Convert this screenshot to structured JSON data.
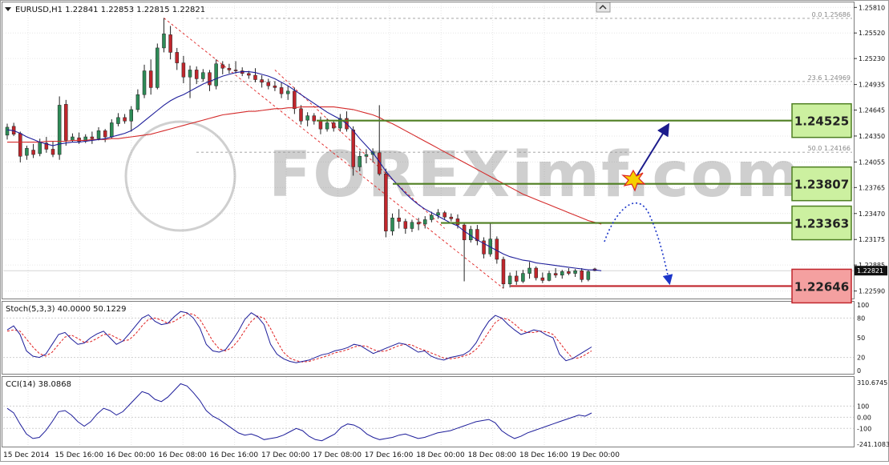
{
  "header": {
    "symbol_caption": "EURUSD,H1  1.22841 1.22853 1.22815 1.22821",
    "menu_icon": "triangle-down-icon",
    "corner_icon": "chart-arrow-icon"
  },
  "price_axis": {
    "ticks": [
      1.2581,
      1.2552,
      1.2523,
      1.24935,
      1.24645,
      1.2435,
      1.24055,
      1.23765,
      1.2347,
      1.23175,
      1.22885,
      1.2259
    ],
    "tick_labels": [
      "1.25810",
      "1.25520",
      "1.25230",
      "1.24935",
      "1.24645",
      "1.24350",
      "1.24055",
      "1.23765",
      "1.23470",
      "1.23175",
      "1.22885",
      "1.22590"
    ],
    "current_price": "1.22821",
    "range": [
      1.2255,
      1.2584
    ]
  },
  "time_axis": [
    "15 Dec 2014",
    "15 Dec 16:00",
    "16 Dec 00:00",
    "16 Dec 08:00",
    "16 Dec 16:00",
    "17 Dec 00:00",
    "17 Dec 08:00",
    "17 Dec 16:00",
    "18 Dec 00:00",
    "18 Dec 08:00",
    "18 Dec 16:00",
    "19 Dec 00:00"
  ],
  "fibonacci": [
    {
      "label": "0.0  1.25686",
      "price": 1.25686
    },
    {
      "label": "23.6  1.24969",
      "price": 1.24969
    },
    {
      "label": "50.0  1.24166",
      "price": 1.24166
    }
  ],
  "levels": [
    {
      "label": "1.24525",
      "price": 1.24525,
      "kind": "resistance",
      "color": "#4f7f22",
      "fill": "#ccf0a0"
    },
    {
      "label": "1.23807",
      "price": 1.23807,
      "kind": "resistance",
      "color": "#4f7f22",
      "fill": "#ccf0a0"
    },
    {
      "label": "1.23363",
      "price": 1.23363,
      "kind": "resistance",
      "color": "#4f7f22",
      "fill": "#ccf0a0"
    },
    {
      "label": "1.22646",
      "price": 1.22646,
      "kind": "support",
      "color": "#c0262c",
      "fill": "#f4a0a0"
    }
  ],
  "watermark": "FOREXimf.com",
  "stoch": {
    "caption": "Stoch(5,3,3) 40.0000 50.1229",
    "tick_labels": [
      "100",
      "80",
      "50",
      "20",
      "0"
    ],
    "tick_values": [
      100,
      80,
      50,
      20,
      0
    ]
  },
  "cci": {
    "caption": "CCI(14) 38.0868",
    "tick_labels": [
      "310.6745",
      "100",
      "0.00",
      "-100",
      "-241.1083"
    ],
    "tick_values": [
      310.6745,
      100,
      0,
      -100,
      -241.1083
    ]
  },
  "colors": {
    "bull": "#2e8b57",
    "bear": "#c0262c",
    "ma_fast": "#1d1d9a",
    "ma_slow": "#d42a2a",
    "stoch_main": "#1d1d9a",
    "stoch_signal": "#e02020",
    "cci": "#1d1d9a",
    "arrow": "#1c1c8c"
  },
  "chart_data": {
    "type": "candlestick",
    "symbol": "EURUSD",
    "timeframe": "H1",
    "candles": [
      {
        "o": 1.2436,
        "h": 1.2449,
        "l": 1.2431,
        "c": 1.2445
      },
      {
        "o": 1.2446,
        "h": 1.245,
        "l": 1.2435,
        "c": 1.2437
      },
      {
        "o": 1.2438,
        "h": 1.244,
        "l": 1.2405,
        "c": 1.2412
      },
      {
        "o": 1.2413,
        "h": 1.2424,
        "l": 1.2408,
        "c": 1.2421
      },
      {
        "o": 1.2419,
        "h": 1.2426,
        "l": 1.241,
        "c": 1.2414
      },
      {
        "o": 1.2415,
        "h": 1.2432,
        "l": 1.2412,
        "c": 1.2428
      },
      {
        "o": 1.2427,
        "h": 1.2434,
        "l": 1.2416,
        "c": 1.242
      },
      {
        "o": 1.242,
        "h": 1.2429,
        "l": 1.2411,
        "c": 1.2414
      },
      {
        "o": 1.2414,
        "h": 1.248,
        "l": 1.2408,
        "c": 1.247
      },
      {
        "o": 1.2471,
        "h": 1.2476,
        "l": 1.2424,
        "c": 1.243
      },
      {
        "o": 1.243,
        "h": 1.2438,
        "l": 1.2428,
        "c": 1.2434
      },
      {
        "o": 1.2433,
        "h": 1.2439,
        "l": 1.2426,
        "c": 1.2429
      },
      {
        "o": 1.2429,
        "h": 1.2437,
        "l": 1.2427,
        "c": 1.2434
      },
      {
        "o": 1.2434,
        "h": 1.244,
        "l": 1.2426,
        "c": 1.2432
      },
      {
        "o": 1.2432,
        "h": 1.2445,
        "l": 1.243,
        "c": 1.2441
      },
      {
        "o": 1.2441,
        "h": 1.2443,
        "l": 1.2428,
        "c": 1.2434
      },
      {
        "o": 1.2434,
        "h": 1.2454,
        "l": 1.2432,
        "c": 1.245
      },
      {
        "o": 1.2449,
        "h": 1.2461,
        "l": 1.2446,
        "c": 1.2456
      },
      {
        "o": 1.2456,
        "h": 1.246,
        "l": 1.2449,
        "c": 1.2452
      },
      {
        "o": 1.2452,
        "h": 1.2469,
        "l": 1.244,
        "c": 1.2465
      },
      {
        "o": 1.2465,
        "h": 1.2488,
        "l": 1.2462,
        "c": 1.2482
      },
      {
        "o": 1.2482,
        "h": 1.2516,
        "l": 1.2478,
        "c": 1.2509
      },
      {
        "o": 1.2509,
        "h": 1.2522,
        "l": 1.2482,
        "c": 1.249
      },
      {
        "o": 1.249,
        "h": 1.254,
        "l": 1.2488,
        "c": 1.2535
      },
      {
        "o": 1.2535,
        "h": 1.2569,
        "l": 1.253,
        "c": 1.2551
      },
      {
        "o": 1.255,
        "h": 1.256,
        "l": 1.2522,
        "c": 1.253
      },
      {
        "o": 1.253,
        "h": 1.2535,
        "l": 1.251,
        "c": 1.2518
      },
      {
        "o": 1.2518,
        "h": 1.2526,
        "l": 1.2495,
        "c": 1.2502
      },
      {
        "o": 1.2502,
        "h": 1.2515,
        "l": 1.2478,
        "c": 1.251
      },
      {
        "o": 1.251,
        "h": 1.2514,
        "l": 1.2494,
        "c": 1.25
      },
      {
        "o": 1.25,
        "h": 1.2511,
        "l": 1.2497,
        "c": 1.2507
      },
      {
        "o": 1.2507,
        "h": 1.251,
        "l": 1.2486,
        "c": 1.2493
      },
      {
        "o": 1.2492,
        "h": 1.2522,
        "l": 1.2488,
        "c": 1.2517
      },
      {
        "o": 1.2516,
        "h": 1.252,
        "l": 1.2505,
        "c": 1.2512
      },
      {
        "o": 1.2512,
        "h": 1.2517,
        "l": 1.2506,
        "c": 1.251
      },
      {
        "o": 1.251,
        "h": 1.252,
        "l": 1.2506,
        "c": 1.2509
      },
      {
        "o": 1.2509,
        "h": 1.2513,
        "l": 1.2503,
        "c": 1.2506
      },
      {
        "o": 1.2506,
        "h": 1.2509,
        "l": 1.25,
        "c": 1.2504
      },
      {
        "o": 1.2504,
        "h": 1.2512,
        "l": 1.2496,
        "c": 1.2499
      },
      {
        "o": 1.2499,
        "h": 1.2504,
        "l": 1.249,
        "c": 1.2496
      },
      {
        "o": 1.2496,
        "h": 1.25,
        "l": 1.2488,
        "c": 1.2492
      },
      {
        "o": 1.2492,
        "h": 1.2497,
        "l": 1.2486,
        "c": 1.249
      },
      {
        "o": 1.249,
        "h": 1.2496,
        "l": 1.2478,
        "c": 1.2483
      },
      {
        "o": 1.2483,
        "h": 1.2492,
        "l": 1.2476,
        "c": 1.2486
      },
      {
        "o": 1.2486,
        "h": 1.249,
        "l": 1.246,
        "c": 1.2466
      },
      {
        "o": 1.2466,
        "h": 1.247,
        "l": 1.2448,
        "c": 1.2452
      },
      {
        "o": 1.2453,
        "h": 1.2462,
        "l": 1.2446,
        "c": 1.2458
      },
      {
        "o": 1.2458,
        "h": 1.2461,
        "l": 1.2448,
        "c": 1.2452
      },
      {
        "o": 1.2452,
        "h": 1.2457,
        "l": 1.2437,
        "c": 1.2443
      },
      {
        "o": 1.2443,
        "h": 1.2455,
        "l": 1.244,
        "c": 1.245
      },
      {
        "o": 1.245,
        "h": 1.2453,
        "l": 1.244,
        "c": 1.2444
      },
      {
        "o": 1.2444,
        "h": 1.246,
        "l": 1.244,
        "c": 1.2455
      },
      {
        "o": 1.2455,
        "h": 1.2463,
        "l": 1.244,
        "c": 1.2443
      },
      {
        "o": 1.2442,
        "h": 1.2446,
        "l": 1.239,
        "c": 1.24
      },
      {
        "o": 1.24,
        "h": 1.2418,
        "l": 1.2395,
        "c": 1.2412
      },
      {
        "o": 1.2412,
        "h": 1.242,
        "l": 1.2404,
        "c": 1.2414
      },
      {
        "o": 1.2414,
        "h": 1.2421,
        "l": 1.2405,
        "c": 1.2417
      },
      {
        "o": 1.2416,
        "h": 1.247,
        "l": 1.239,
        "c": 1.2392
      },
      {
        "o": 1.2392,
        "h": 1.2398,
        "l": 1.232,
        "c": 1.2327
      },
      {
        "o": 1.2327,
        "h": 1.2347,
        "l": 1.2322,
        "c": 1.2342
      },
      {
        "o": 1.2342,
        "h": 1.2352,
        "l": 1.233,
        "c": 1.2338
      },
      {
        "o": 1.2338,
        "h": 1.2341,
        "l": 1.2324,
        "c": 1.233
      },
      {
        "o": 1.233,
        "h": 1.234,
        "l": 1.2326,
        "c": 1.2337
      },
      {
        "o": 1.2337,
        "h": 1.2342,
        "l": 1.2328,
        "c": 1.2335
      },
      {
        "o": 1.2335,
        "h": 1.2344,
        "l": 1.233,
        "c": 1.234
      },
      {
        "o": 1.234,
        "h": 1.2349,
        "l": 1.2337,
        "c": 1.2345
      },
      {
        "o": 1.2345,
        "h": 1.2352,
        "l": 1.2341,
        "c": 1.2348
      },
      {
        "o": 1.2348,
        "h": 1.235,
        "l": 1.234,
        "c": 1.2343
      },
      {
        "o": 1.2343,
        "h": 1.2347,
        "l": 1.2338,
        "c": 1.2341
      },
      {
        "o": 1.2341,
        "h": 1.2346,
        "l": 1.233,
        "c": 1.2334
      },
      {
        "o": 1.2334,
        "h": 1.2337,
        "l": 1.227,
        "c": 1.2317
      },
      {
        "o": 1.2317,
        "h": 1.2333,
        "l": 1.2314,
        "c": 1.2329
      },
      {
        "o": 1.2329,
        "h": 1.2334,
        "l": 1.2311,
        "c": 1.2316
      },
      {
        "o": 1.2316,
        "h": 1.232,
        "l": 1.2296,
        "c": 1.2301
      },
      {
        "o": 1.2301,
        "h": 1.2336,
        "l": 1.2298,
        "c": 1.2318
      },
      {
        "o": 1.2318,
        "h": 1.2321,
        "l": 1.229,
        "c": 1.2295
      },
      {
        "o": 1.2295,
        "h": 1.2298,
        "l": 1.2262,
        "c": 1.2267
      },
      {
        "o": 1.2267,
        "h": 1.228,
        "l": 1.2263,
        "c": 1.2276
      },
      {
        "o": 1.2276,
        "h": 1.2282,
        "l": 1.2266,
        "c": 1.227
      },
      {
        "o": 1.227,
        "h": 1.2283,
        "l": 1.2268,
        "c": 1.2279
      },
      {
        "o": 1.2279,
        "h": 1.2292,
        "l": 1.2273,
        "c": 1.2285
      },
      {
        "o": 1.2285,
        "h": 1.2287,
        "l": 1.2271,
        "c": 1.2274
      },
      {
        "o": 1.2274,
        "h": 1.228,
        "l": 1.2268,
        "c": 1.2271
      },
      {
        "o": 1.2271,
        "h": 1.2282,
        "l": 1.227,
        "c": 1.2279
      },
      {
        "o": 1.2279,
        "h": 1.2285,
        "l": 1.2274,
        "c": 1.2277
      },
      {
        "o": 1.2277,
        "h": 1.2283,
        "l": 1.2273,
        "c": 1.2281
      },
      {
        "o": 1.2281,
        "h": 1.2285,
        "l": 1.2277,
        "c": 1.2279
      },
      {
        "o": 1.2279,
        "h": 1.2284,
        "l": 1.2275,
        "c": 1.2282
      },
      {
        "o": 1.2282,
        "h": 1.2285,
        "l": 1.2269,
        "c": 1.2272
      },
      {
        "o": 1.2272,
        "h": 1.2283,
        "l": 1.227,
        "c": 1.2281
      },
      {
        "o": 1.22841,
        "h": 1.22853,
        "l": 1.22815,
        "c": 1.22821
      }
    ],
    "ma_fast": [
      1.2442,
      1.2441,
      1.2438,
      1.2434,
      1.2431,
      1.2428,
      1.2426,
      1.2424,
      1.2426,
      1.2427,
      1.2428,
      1.2428,
      1.2429,
      1.243,
      1.2431,
      1.2432,
      1.2434,
      1.2436,
      1.2438,
      1.2441,
      1.2446,
      1.2452,
      1.2458,
      1.2464,
      1.247,
      1.2475,
      1.2479,
      1.2482,
      1.2486,
      1.249,
      1.2494,
      1.2497,
      1.25,
      1.2503,
      1.2505,
      1.2507,
      1.2508,
      1.2508,
      1.2507,
      1.2505,
      1.2503,
      1.25,
      1.2496,
      1.2492,
      1.2487,
      1.2482,
      1.2477,
      1.2472,
      1.2467,
      1.2462,
      1.2458,
      1.2454,
      1.2449,
      1.2441,
      1.2432,
      1.2424,
      1.2416,
      1.2406,
      1.2395,
      1.2386,
      1.2378,
      1.237,
      1.2363,
      1.2357,
      1.2352,
      1.2348,
      1.2344,
      1.234,
      1.2336,
      1.2333,
      1.2327,
      1.2322,
      1.2317,
      1.2313,
      1.2309,
      1.2305,
      1.2301,
      1.2298,
      1.2296,
      1.2294,
      1.2293,
      1.2291,
      1.229,
      1.2289,
      1.2288,
      1.2287,
      1.2286,
      1.2285,
      1.2284,
      1.2283,
      1.2283,
      1.2282
    ],
    "ma_slow": [
      1.2428,
      1.2428,
      1.2428,
      1.2428,
      1.2428,
      1.2428,
      1.2429,
      1.2429,
      1.2429,
      1.2429,
      1.243,
      1.243,
      1.243,
      1.2431,
      1.2431,
      1.2431,
      1.2432,
      1.2432,
      1.2433,
      1.2434,
      1.2435,
      1.2436,
      1.2437,
      1.2439,
      1.2441,
      1.2443,
      1.2445,
      1.2447,
      1.2449,
      1.2451,
      1.2453,
      1.2455,
      1.2457,
      1.2459,
      1.246,
      1.2461,
      1.2462,
      1.2463,
      1.2463,
      1.2464,
      1.2465,
      1.2466,
      1.2466,
      1.2467,
      1.2467,
      1.2468,
      1.2468,
      1.2468,
      1.2468,
      1.2468,
      1.2468,
      1.2467,
      1.2466,
      1.2465,
      1.2463,
      1.2461,
      1.2459,
      1.2456,
      1.2452,
      1.2449,
      1.2445,
      1.2441,
      1.2437,
      1.2433,
      1.2429,
      1.2425,
      1.2421,
      1.2417,
      1.2413,
      1.2409,
      1.2405,
      1.2401,
      1.2397,
      1.2393,
      1.2389,
      1.2385,
      1.2381,
      1.2377,
      1.2373,
      1.2369,
      1.2366,
      1.2363,
      1.236,
      1.2357,
      1.2354,
      1.2351,
      1.2348,
      1.2345,
      1.2342,
      1.2339,
      1.2337,
      1.2335
    ],
    "stoch_main": [
      62,
      68,
      55,
      30,
      22,
      20,
      25,
      40,
      55,
      58,
      48,
      40,
      42,
      50,
      56,
      60,
      50,
      40,
      45,
      56,
      68,
      80,
      85,
      75,
      70,
      72,
      82,
      90,
      88,
      80,
      65,
      40,
      30,
      28,
      32,
      45,
      60,
      78,
      88,
      82,
      70,
      40,
      25,
      18,
      14,
      12,
      14,
      16,
      20,
      24,
      26,
      30,
      32,
      35,
      40,
      38,
      32,
      26,
      30,
      34,
      38,
      42,
      40,
      34,
      28,
      30,
      22,
      18,
      16,
      20,
      22,
      24,
      30,
      42,
      60,
      75,
      84,
      80,
      70,
      62,
      55,
      58,
      62,
      60,
      54,
      50,
      25,
      15,
      18,
      24,
      30,
      36
    ],
    "stoch_signal": [
      60,
      62,
      60,
      48,
      36,
      26,
      22,
      28,
      40,
      51,
      54,
      49,
      43,
      44,
      49,
      55,
      55,
      50,
      45,
      47,
      56,
      68,
      78,
      80,
      77,
      72,
      75,
      81,
      87,
      86,
      78,
      62,
      45,
      33,
      30,
      35,
      46,
      61,
      75,
      83,
      80,
      64,
      45,
      28,
      19,
      15,
      13,
      14,
      17,
      20,
      23,
      27,
      29,
      32,
      36,
      38,
      37,
      32,
      29,
      30,
      34,
      38,
      40,
      39,
      34,
      31,
      27,
      23,
      19,
      18,
      19,
      22,
      25,
      32,
      44,
      59,
      73,
      80,
      78,
      71,
      62,
      58,
      58,
      60,
      59,
      55,
      43,
      30,
      19,
      19,
      24,
      30
    ],
    "cci": [
      80,
      40,
      -60,
      -150,
      -190,
      -180,
      -120,
      -40,
      50,
      60,
      20,
      -40,
      -80,
      -40,
      30,
      80,
      60,
      20,
      50,
      110,
      170,
      230,
      210,
      160,
      140,
      180,
      240,
      300,
      280,
      220,
      150,
      60,
      10,
      -20,
      -60,
      -100,
      -140,
      -160,
      -150,
      -170,
      -200,
      -190,
      -180,
      -160,
      -130,
      -100,
      -120,
      -170,
      -200,
      -210,
      -180,
      -150,
      -90,
      -60,
      -70,
      -100,
      -150,
      -180,
      -200,
      -190,
      -180,
      -160,
      -150,
      -170,
      -190,
      -180,
      -160,
      -140,
      -130,
      -120,
      -100,
      -80,
      -60,
      -40,
      -30,
      -20,
      -50,
      -120,
      -160,
      -190,
      -170,
      -140,
      -120,
      -100,
      -80,
      -60,
      -40,
      -20,
      0,
      20,
      10,
      38.0868
    ],
    "price_range": [
      1.2255,
      1.2584
    ],
    "stoch_range": [
      0,
      100
    ],
    "cci_range": [
      -241.1083,
      310.6745
    ]
  }
}
